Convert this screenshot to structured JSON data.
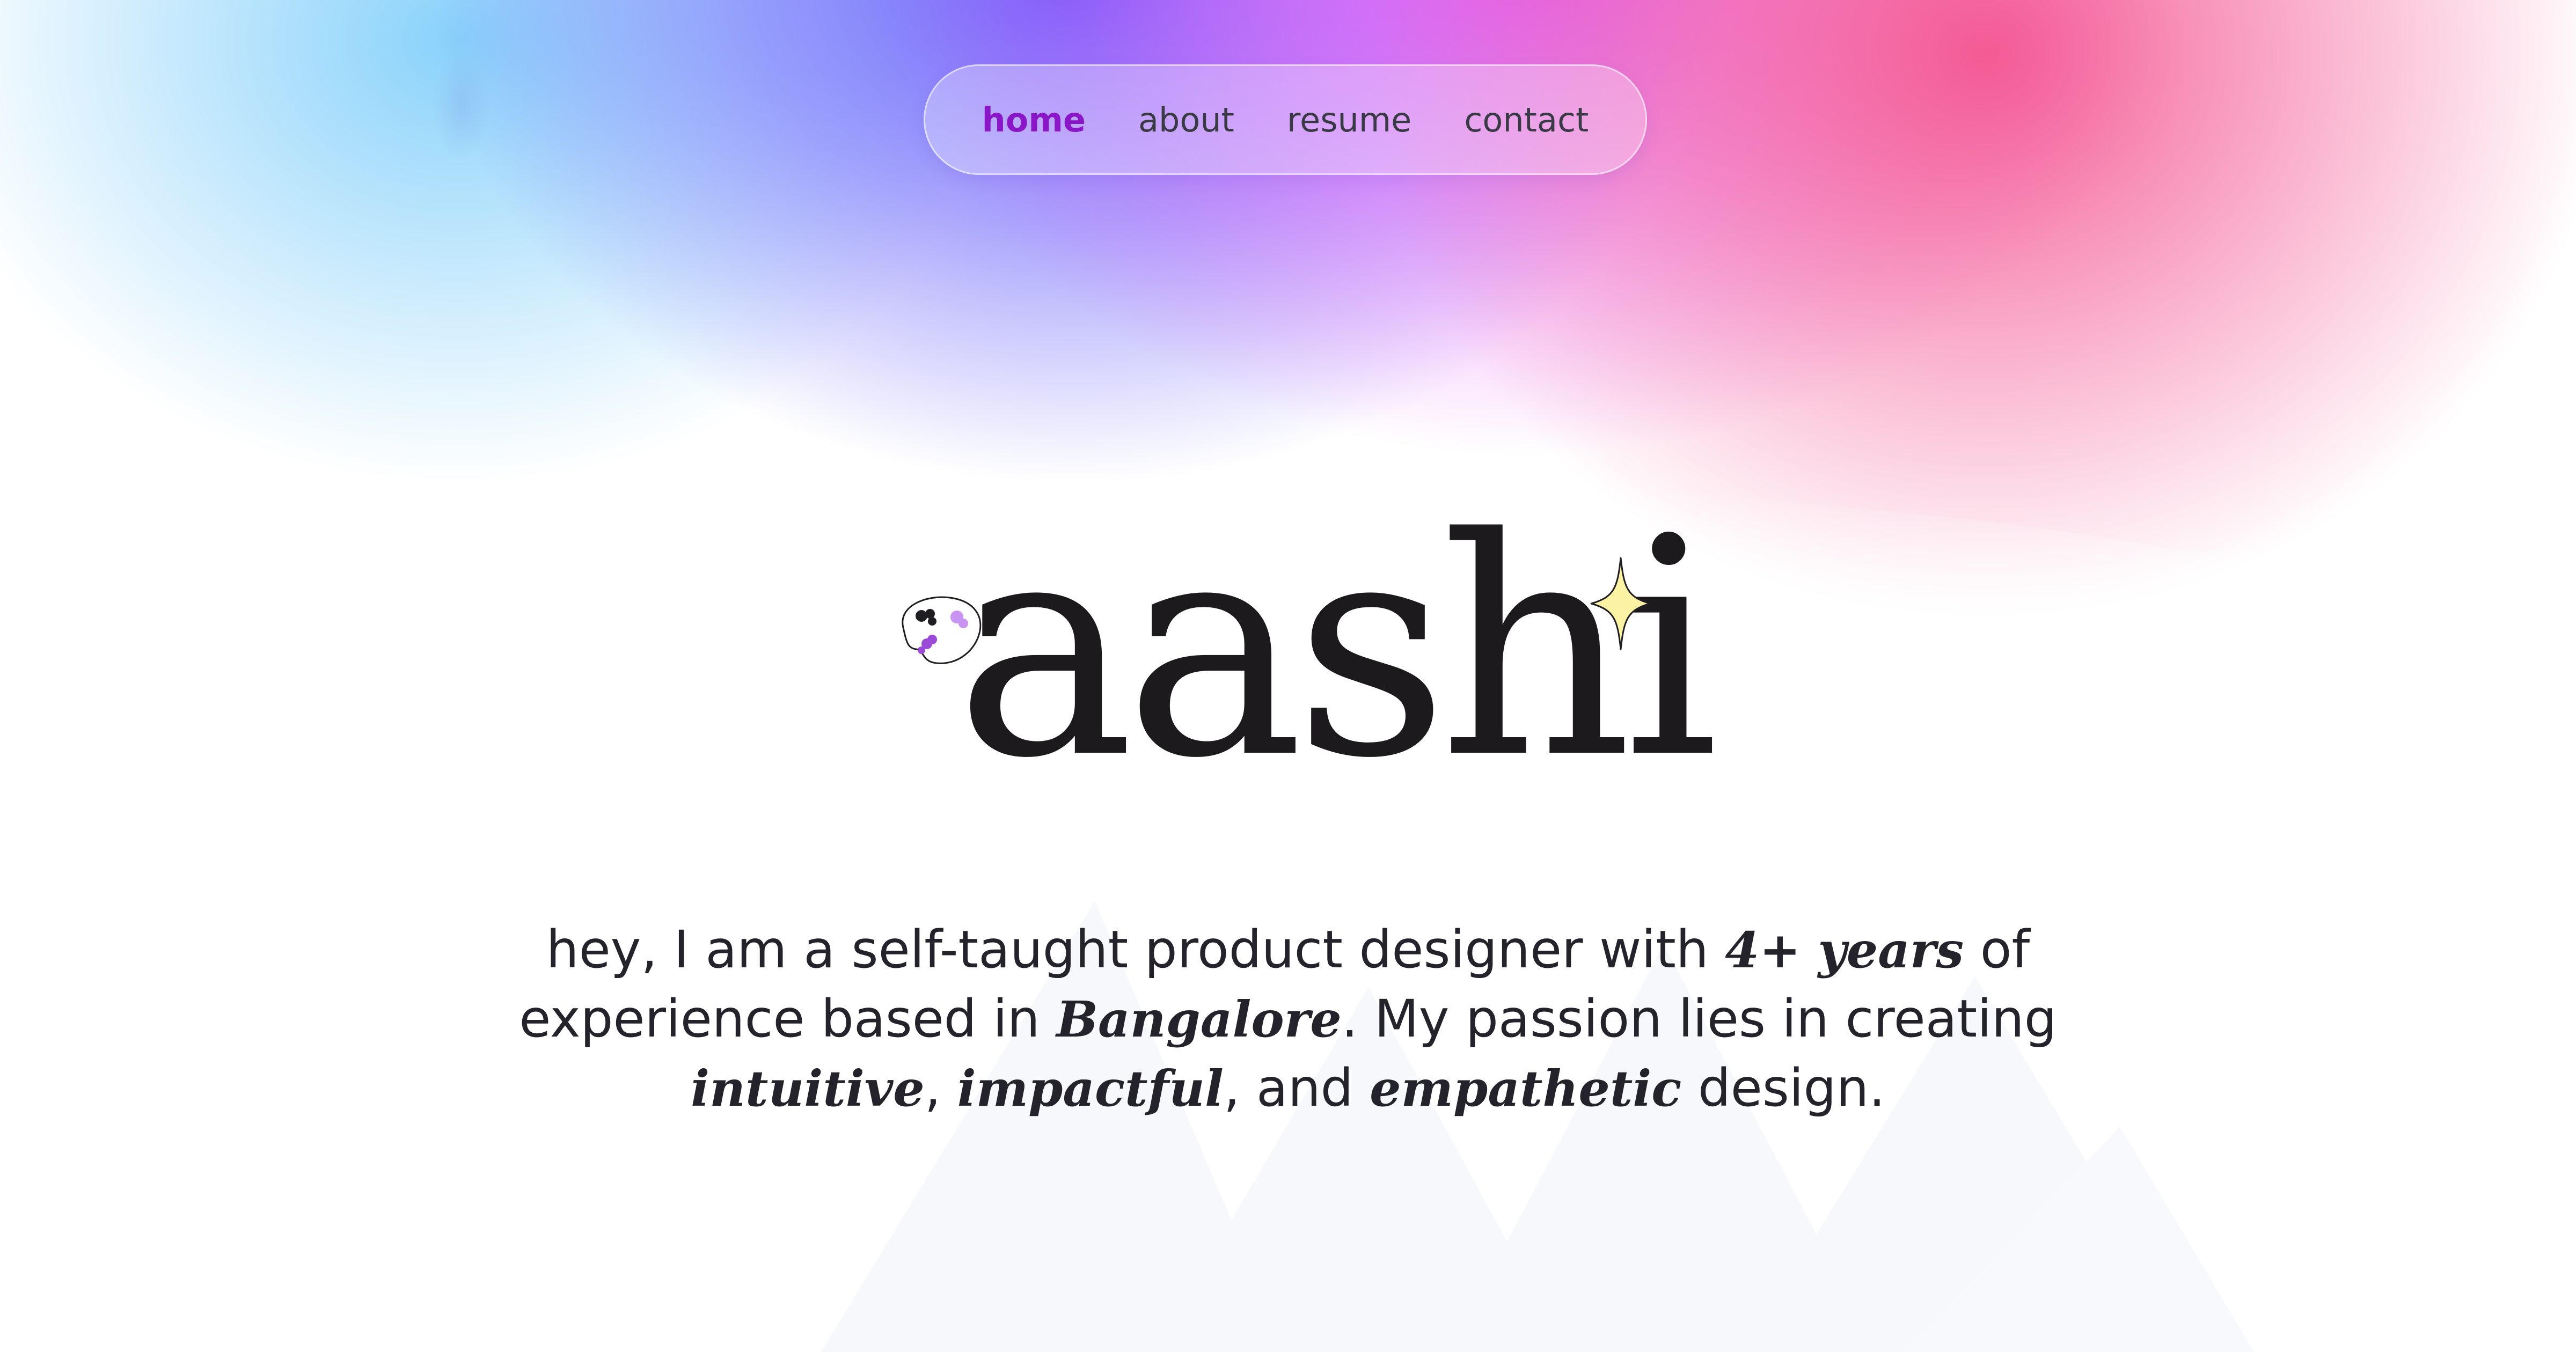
{
  "nav": {
    "items": [
      {
        "label": "home",
        "active": true
      },
      {
        "label": "about",
        "active": false
      },
      {
        "label": "resume",
        "active": false
      },
      {
        "label": "contact",
        "active": false
      }
    ],
    "active_color": "#8a16c7"
  },
  "hero": {
    "name": "aashi",
    "icons": [
      "art-palette-icon",
      "sparkle-icon"
    ]
  },
  "intro": {
    "text_1": "hey, I am a self-taught product designer with ",
    "years": "4+ years",
    "text_2": " of experience based in ",
    "city": "Bangalore",
    "text_3": ". My passion lies in creating ",
    "word_1": "intuitive",
    "text_4": ", ",
    "word_2": "impactful",
    "text_5": ", and ",
    "word_3": "empathetic",
    "text_6": " design."
  },
  "colors": {
    "text": "#24222a",
    "gradient_cyan": "#7ccdfa",
    "gradient_blue": "#645cfa",
    "gradient_magenta": "#e45af6",
    "gradient_pink": "#f45a94"
  }
}
